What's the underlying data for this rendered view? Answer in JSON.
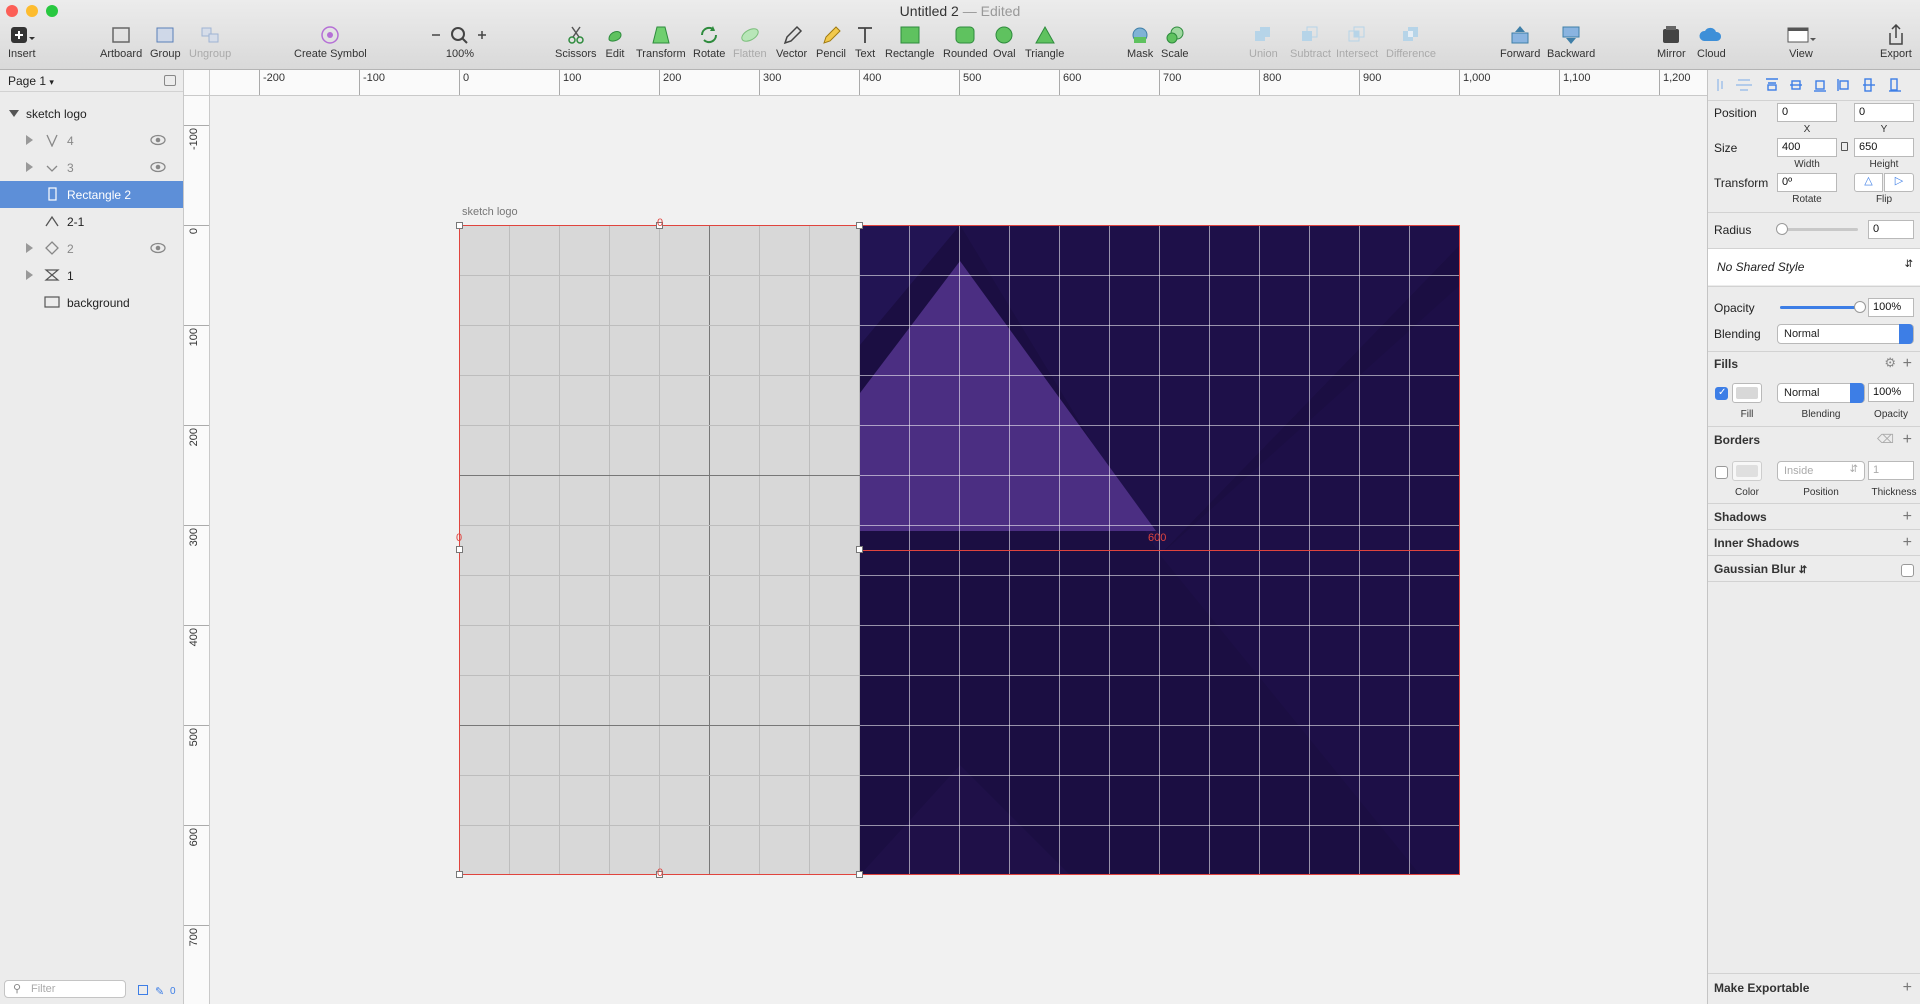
{
  "window": {
    "title": "Untitled 2",
    "edited": "— Edited"
  },
  "toolbar": {
    "insert": "Insert",
    "artboard": "Artboard",
    "group": "Group",
    "ungroup": "Ungroup",
    "create_symbol": "Create Symbol",
    "zoom_level": "100%",
    "scissors": "Scissors",
    "edit": "Edit",
    "transform": "Transform",
    "rotate": "Rotate",
    "flatten": "Flatten",
    "vector": "Vector",
    "pencil": "Pencil",
    "text": "Text",
    "rectangle": "Rectangle",
    "rounded": "Rounded",
    "oval": "Oval",
    "triangle": "Triangle",
    "mask": "Mask",
    "scale": "Scale",
    "union": "Union",
    "subtract": "Subtract",
    "intersect": "Intersect",
    "difference": "Difference",
    "forward": "Forward",
    "backward": "Backward",
    "mirror": "Mirror",
    "cloud": "Cloud",
    "view": "View",
    "export": "Export"
  },
  "sidebar": {
    "page_selector": "Page 1",
    "layers": [
      {
        "label": "sketch logo"
      },
      {
        "label": "4"
      },
      {
        "label": "3"
      },
      {
        "label": "Rectangle 2"
      },
      {
        "label": "2-1"
      },
      {
        "label": "2"
      },
      {
        "label": "1"
      },
      {
        "label": "background"
      }
    ],
    "filter_placeholder": "Filter",
    "filter_count": "0"
  },
  "rulers": {
    "horizontal": [
      "-200",
      "-100",
      "0",
      "100",
      "200",
      "300",
      "400",
      "500",
      "600",
      "700",
      "800",
      "900",
      "1,000",
      "1,100",
      "1,200"
    ],
    "vertical": [
      "-100",
      "0",
      "100",
      "200",
      "300",
      "400",
      "500",
      "600",
      "700"
    ]
  },
  "canvas": {
    "artboard_label": "sketch logo",
    "measure_left": "0",
    "measure_top": "0",
    "measure_bottom": "0",
    "measure_right": "600"
  },
  "inspector": {
    "position_label": "Position",
    "x_value": "0",
    "y_value": "0",
    "x_label": "X",
    "y_label": "Y",
    "size_label": "Size",
    "width_value": "400",
    "height_value": "650",
    "width_label": "Width",
    "height_label": "Height",
    "transform_label": "Transform",
    "rotate_value": "0º",
    "rotate_label": "Rotate",
    "flip_label": "Flip",
    "radius_label": "Radius",
    "radius_value": "0",
    "shared_style": "No Shared Style",
    "opacity_label": "Opacity",
    "opacity_value": "100%",
    "opacity_level": 1.0,
    "blending_label": "Blending",
    "blending_value": "Normal",
    "fills_title": "Fills",
    "fill_blending": "Normal",
    "fill_opacity": "100%",
    "fill_label": "Fill",
    "fill_blending_label": "Blending",
    "fill_opacity_label": "Opacity",
    "borders_title": "Borders",
    "border_position": "Inside",
    "border_thickness": "1",
    "color_label": "Color",
    "position_sub_label": "Position",
    "thickness_label": "Thickness",
    "shadows_title": "Shadows",
    "inner_shadows_title": "Inner Shadows",
    "gaussian_blur": "Gaussian Blur",
    "make_exportable": "Make Exportable"
  },
  "colors": {
    "accent": "#3d7ee6",
    "selection": "#5d8fd8",
    "artboard_dark": "#1b0e42",
    "highlight": "#e0443e"
  }
}
